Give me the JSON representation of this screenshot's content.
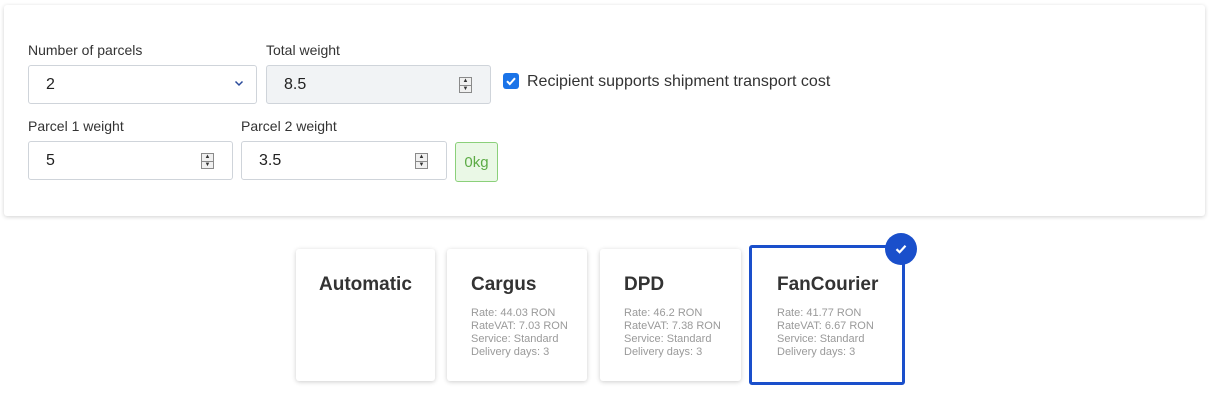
{
  "form": {
    "parcels_label": "Number of parcels",
    "parcels_value": "2",
    "total_weight_label": "Total weight",
    "total_weight_value": "8.5",
    "recipient_pays_label": "Recipient supports shipment transport cost",
    "recipient_pays_checked": true,
    "parcel1_label": "Parcel 1 weight",
    "parcel1_value": "5",
    "parcel2_label": "Parcel 2 weight",
    "parcel2_value": "3.5",
    "remaining_badge": "0kg"
  },
  "couriers": [
    {
      "name": "Automatic"
    },
    {
      "name": "Cargus",
      "rate": "Rate: 44.03 RON",
      "rate_vat": "RateVAT: 7.03 RON",
      "service": "Service: Standard",
      "days": "Delivery days: 3"
    },
    {
      "name": "DPD",
      "rate": "Rate: 46.2 RON",
      "rate_vat": "RateVAT: 7.38 RON",
      "service": "Service: Standard",
      "days": "Delivery days: 3"
    },
    {
      "name": "FanCourier",
      "rate": "Rate: 41.77 RON",
      "rate_vat": "RateVAT: 6.67 RON",
      "service": "Service: Standard",
      "days": "Delivery days: 3",
      "selected": true
    }
  ],
  "colors": {
    "accent": "#1a4fcb",
    "checkbox": "#1a73e8",
    "badge_green": "#5cab45"
  },
  "icons": {
    "select": "chevron-down-icon",
    "spinner": "spinner-arrows-icon",
    "checked": "checkmark-icon"
  }
}
